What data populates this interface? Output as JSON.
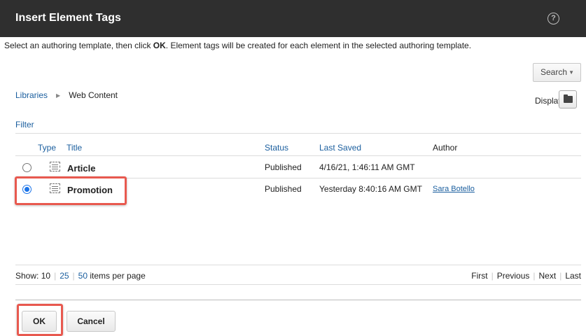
{
  "dialog": {
    "title": "Insert Element Tags",
    "help_icon": "question-circle-icon",
    "instructions": {
      "pre": "Select an authoring template, then click ",
      "bold": "OK",
      "post": ". Element tags will be created for each element in the selected authoring template."
    }
  },
  "toolbar": {
    "search_label": "Search",
    "search_caret": "▼"
  },
  "breadcrumb": {
    "root": "Libraries",
    "separator": "▶",
    "current": "Web Content"
  },
  "display": {
    "label": "Display:",
    "icon": "folder-icon"
  },
  "filter_label": "Filter",
  "table": {
    "columns": {
      "type": "Type",
      "title": "Title",
      "status": "Status",
      "last_saved": "Last Saved",
      "author": "Author"
    },
    "rows": [
      {
        "selected": false,
        "icon": "authoring-template-icon",
        "title": "Article",
        "status": "Published",
        "last_saved": "4/16/21, 1:46:11 AM GMT",
        "author": ""
      },
      {
        "selected": true,
        "icon": "authoring-template-icon",
        "title": "Promotion",
        "status": "Published",
        "last_saved": "Yesterday 8:40:16 AM GMT",
        "author": "Sara Botello"
      }
    ]
  },
  "pager": {
    "show_label": "Show:",
    "sizes": [
      "10",
      "25",
      "50"
    ],
    "suffix": "items per page",
    "nav": {
      "first": "First",
      "previous": "Previous",
      "next": "Next",
      "last": "Last"
    }
  },
  "buttons": {
    "ok": "OK",
    "cancel": "Cancel"
  },
  "colors": {
    "link": "#1a5e9e",
    "highlight": "#e8594f",
    "titlebar": "#2f2f2f",
    "radio": "#1a73e8"
  }
}
